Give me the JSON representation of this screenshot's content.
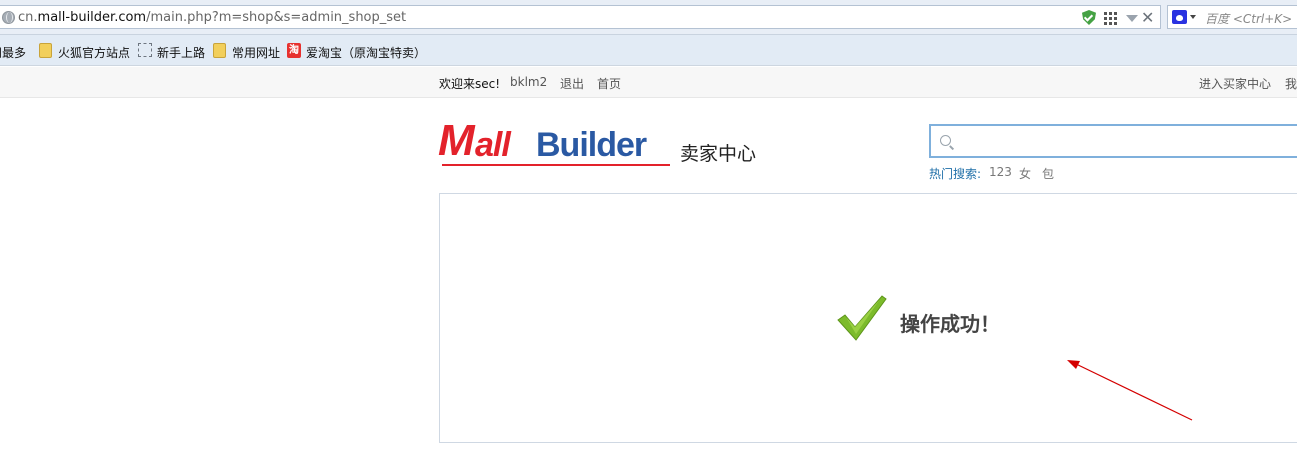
{
  "browser": {
    "url_prefix": "cn.",
    "url_domain": "mall-builder.com",
    "url_path": "/main.php?m=shop&s=admin_shop_set",
    "search_placeholder": "百度 <Ctrl+K>"
  },
  "bookmarks": [
    "问最多",
    "火狐官方站点",
    "新手上路",
    "常用网址",
    "爱淘宝（原淘宝特卖）"
  ],
  "taobao_icon_text": "淘",
  "site_top": {
    "welcome": "欢迎来sec!",
    "username": "bklm2",
    "logout": "退出",
    "home": "首页",
    "buyer_center": "进入买家中心",
    "right_cut": "我"
  },
  "header": {
    "logo_m": "M",
    "logo_all": "all",
    "logo_builder": "Builder",
    "center_title": "卖家中心",
    "hot_label": "热门搜索:",
    "hot_words": [
      "123",
      "女",
      "包"
    ]
  },
  "message": {
    "text": "操作成功！"
  },
  "colors": {
    "logo_red": "#e3222b",
    "logo_blue": "#2a59a3",
    "check_green": "#7cbb2b",
    "arrow_red": "#d40000"
  }
}
